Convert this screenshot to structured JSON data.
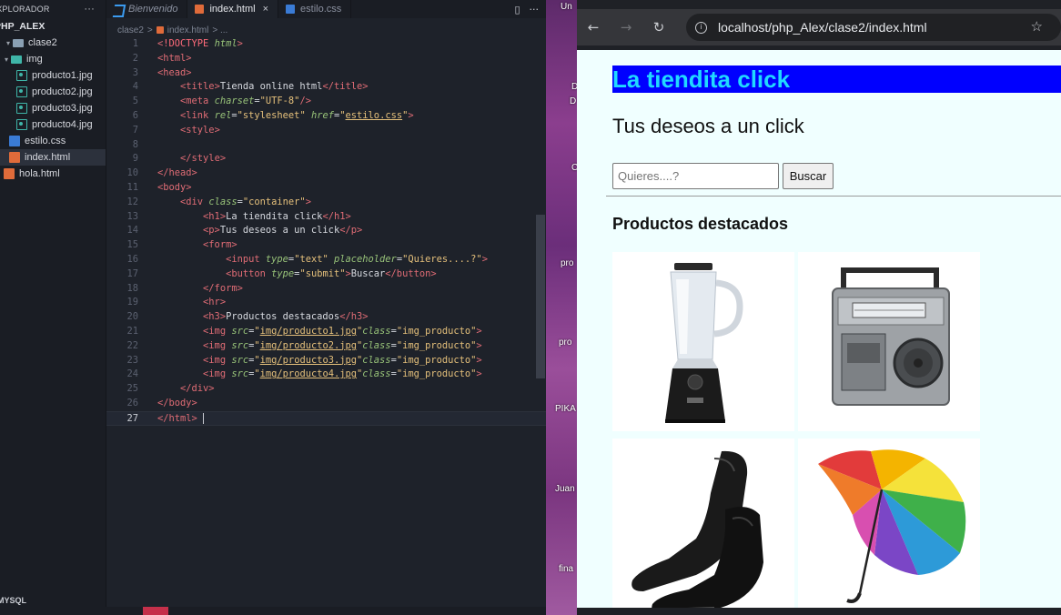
{
  "explorer": {
    "header": "EXPLORADOR",
    "folder": "PHP_ALEX",
    "items": [
      {
        "label": "clase2"
      },
      {
        "label": "img"
      },
      {
        "label": "producto1.jpg"
      },
      {
        "label": "producto2.jpg"
      },
      {
        "label": "producto3.jpg"
      },
      {
        "label": "producto4.jpg"
      },
      {
        "label": "estilo.css"
      },
      {
        "label": "index.html"
      },
      {
        "label": "hola.html"
      }
    ],
    "bottom_section": "MYSQL"
  },
  "tabs": [
    {
      "label": "Bienvenido"
    },
    {
      "label": "index.html"
    },
    {
      "label": "estilo.css"
    }
  ],
  "breadcrumb": {
    "folder": "clase2",
    "sep": ">",
    "file": "index.html",
    "tail": "> ..."
  },
  "editor": {
    "line_numbers": [
      "1",
      "2",
      "3",
      "4",
      "5",
      "6",
      "7",
      "8",
      "9",
      "10",
      "11",
      "12",
      "13",
      "14",
      "15",
      "16",
      "17",
      "18",
      "19",
      "20",
      "21",
      "22",
      "23",
      "24",
      "25",
      "26",
      "27"
    ],
    "current_line": 27
  },
  "browser": {
    "url": "localhost/php_Alex/clase2/index.html"
  },
  "page": {
    "title": "La tiendita click",
    "subtitle": "Tus deseos a un click",
    "search_placeholder": "Quieres....?",
    "search_button": "Buscar",
    "section_heading": "Productos destacados",
    "products": [
      {
        "name": "producto1.jpg"
      },
      {
        "name": "producto2.jpg"
      },
      {
        "name": "producto3.jpg"
      },
      {
        "name": "producto4.jpg"
      }
    ]
  },
  "colors": {
    "title_bg": "#0000ff",
    "title_text": "#20d9ff",
    "page_bg": "#f0ffff"
  },
  "desktop": {
    "labels": [
      "Un",
      "D",
      "D",
      "C",
      "pro",
      "pro",
      "PIKA",
      "Juan",
      "fina"
    ]
  }
}
